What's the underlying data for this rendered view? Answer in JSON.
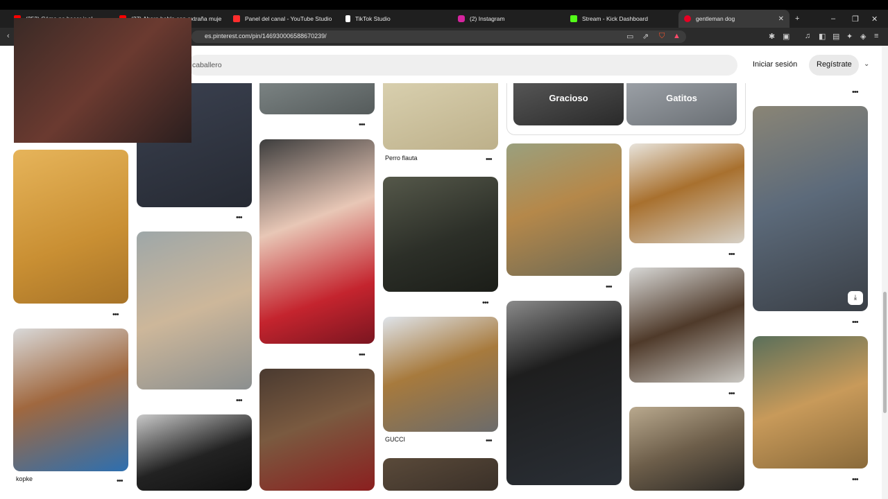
{
  "tabs": [
    {
      "label": "(253) Cómo no hacer ir al ...",
      "icon_color": "#ff0000"
    },
    {
      "label": "(37) Ahora hablo con extraña muje",
      "icon_color": "#ff0000"
    },
    {
      "label": "Panel del canal - YouTube Studio",
      "icon_color": "#ff2d2d"
    },
    {
      "label": "TikTok Studio",
      "icon_color": "#ffffff"
    },
    {
      "label": "(2) Instagram",
      "icon_color": "#d6249f"
    },
    {
      "label": "Stream - Kick Dashboard",
      "icon_color": "#53fc18"
    },
    {
      "label": "gentleman dog",
      "icon_color": "#e60023"
    }
  ],
  "address": {
    "url": "es.pinterest.com/pin/146930006588670239/"
  },
  "header": {
    "search_placeholder": "caballero",
    "login": "Iniciar sesión",
    "register": "Regístrate"
  },
  "pills": [
    {
      "label": "Gracioso"
    },
    {
      "label": "Gatitos"
    }
  ],
  "captions": {
    "perro": "Perro flauta",
    "gucci": "GUCCI",
    "kopke": "kopke"
  },
  "icons": {
    "more": "more-dots-icon",
    "download": "download-icon",
    "close": "close-icon",
    "new_tab": "plus-icon"
  }
}
